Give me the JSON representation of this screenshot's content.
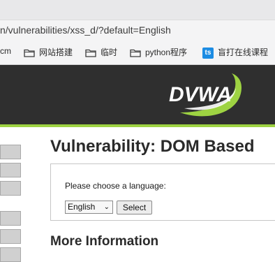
{
  "browser": {
    "url": "n/vulnerabilities/xss_d/?default=English",
    "bookmarks": [
      {
        "label": "cm",
        "icon": "none"
      },
      {
        "label": "网站搭建",
        "icon": "folder-icon"
      },
      {
        "label": "临时",
        "icon": "folder-icon"
      },
      {
        "label": "python程序",
        "icon": "folder-icon"
      },
      {
        "label": "盲打在线课程",
        "icon": "ts-icon",
        "badge": "ts"
      }
    ]
  },
  "header": {
    "logo_text": "DVWA",
    "accent_color": "#9ed342",
    "background_color": "#2f2f2f"
  },
  "main": {
    "title": "Vulnerability: DOM Based",
    "form": {
      "prompt": "Please choose a language:",
      "selected_language": "English",
      "button_label": "Select"
    },
    "more_info_heading": "More Information"
  }
}
